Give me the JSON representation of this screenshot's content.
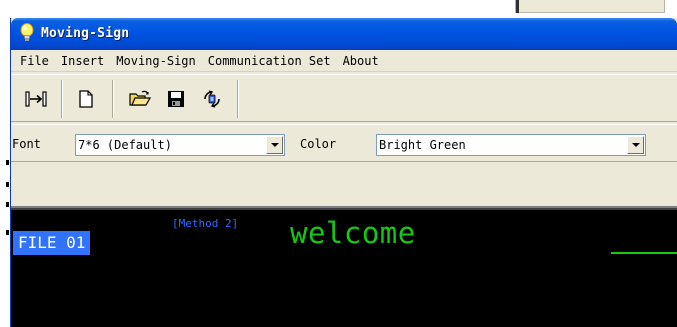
{
  "window": {
    "title": "Moving-Sign",
    "icon": "lightbulb-icon"
  },
  "menu": {
    "items": [
      {
        "label": "File"
      },
      {
        "label": "Insert"
      },
      {
        "label": "Moving-Sign"
      },
      {
        "label": "Communication Set"
      },
      {
        "label": "About"
      }
    ]
  },
  "toolbar": {
    "buttons": [
      {
        "icon": "connect-arrows-icon"
      },
      {
        "icon": "new-document-icon"
      },
      {
        "icon": "open-folder-icon"
      },
      {
        "icon": "save-disk-icon"
      },
      {
        "icon": "send-to-sign-icon"
      }
    ]
  },
  "fontbar": {
    "font_label": "Font",
    "font_value": "7*6 (Default)",
    "color_label": "Color",
    "color_value": "Bright Green"
  },
  "canvas": {
    "file_label": "FILE 01",
    "method_label": "[Method 2]",
    "message": "welcome",
    "colors": {
      "background": "#000000",
      "message": "#14c814",
      "file_highlight": "#3173ff",
      "method_text": "#2f67ff"
    }
  }
}
